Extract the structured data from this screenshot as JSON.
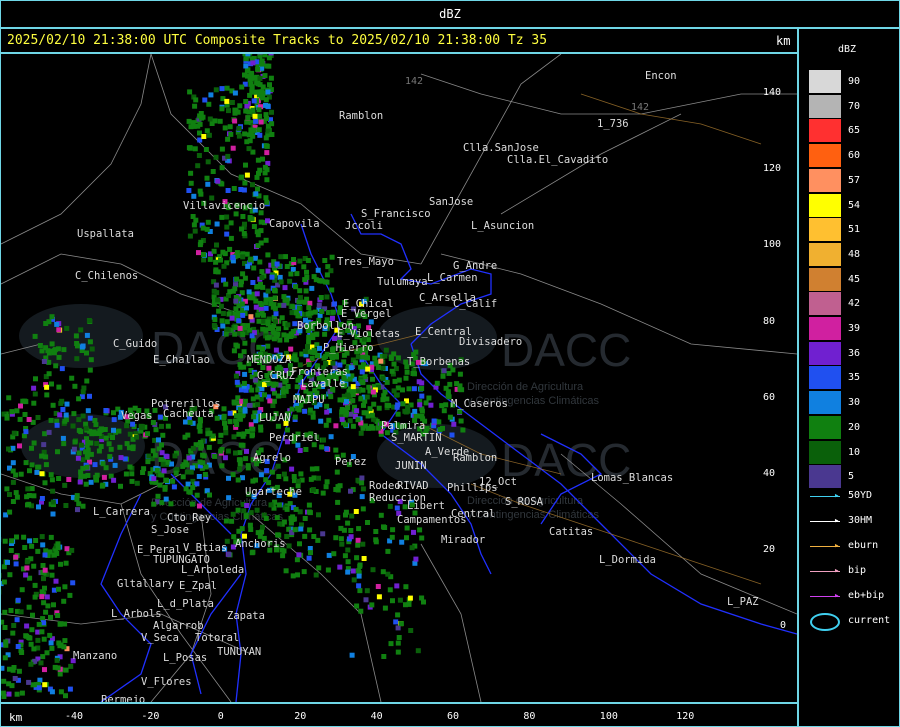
{
  "header": {
    "product": "dBZ"
  },
  "title": "2025/02/10 21:38:00 UTC Composite Tracks to 2025/02/10 21:38:00 Tz 35",
  "km_label_right": "km",
  "km_label_bottom": "km",
  "y_ticks": [
    "140",
    "120",
    "100",
    "80",
    "60",
    "40",
    "20",
    "0"
  ],
  "x_ticks": [
    "-40",
    "-20",
    "0",
    "20",
    "40",
    "60",
    "80",
    "100",
    "120"
  ],
  "legend": {
    "unit": "dBZ",
    "levels": [
      {
        "value": "90",
        "color": "#d8d8d8"
      },
      {
        "value": "70",
        "color": "#b4b4b4"
      },
      {
        "value": "65",
        "color": "#ff3030"
      },
      {
        "value": "60",
        "color": "#ff6010"
      },
      {
        "value": "57",
        "color": "#ff9060"
      },
      {
        "value": "54",
        "color": "#ffff00"
      },
      {
        "value": "51",
        "color": "#ffc030"
      },
      {
        "value": "48",
        "color": "#f0b030"
      },
      {
        "value": "45",
        "color": "#d08030"
      },
      {
        "value": "42",
        "color": "#c06090"
      },
      {
        "value": "39",
        "color": "#d020a0"
      },
      {
        "value": "36",
        "color": "#7020d0"
      },
      {
        "value": "35",
        "color": "#2050f0"
      },
      {
        "value": "30",
        "color": "#1080e0"
      },
      {
        "value": "20",
        "color": "#108010"
      },
      {
        "value": "10",
        "color": "#0a600a"
      },
      {
        "value": "5",
        "color": "#4a3890"
      }
    ]
  },
  "tracks": [
    {
      "label": "50YD",
      "color": "#40d0f0"
    },
    {
      "label": "30HM",
      "color": "#ffffff"
    },
    {
      "label": "eburn",
      "color": "#f0b040"
    },
    {
      "label": "bip",
      "color": "#f0a0c0"
    },
    {
      "label": "eb+bip",
      "color": "#d040f0"
    },
    {
      "label": "current",
      "color": "#40d0f0"
    }
  ],
  "watermark": {
    "name": "DACC",
    "subtitle1": "Dirección de Agricultura",
    "subtitle2": "y Contingencias Climáticas"
  },
  "places": [
    "Encon",
    "1_736",
    "Ramblon",
    "Clla.SanJose",
    "Clla.El_Cavadito",
    "S_Francisco",
    "SanJose",
    "Jccoli",
    "L_Asuncion",
    "Uspallata",
    "Villavicencio",
    "Capovila",
    "Tres_Mayo",
    "G_Andre",
    "Tulumaya",
    "L_Carmen",
    "C_Chilenos",
    "E_Chical",
    "C_Arsella",
    "C_Calif",
    "E_Vergel",
    "Borbollon",
    "E_Central",
    "Divisadero",
    "C_Guido",
    "E_Violetas",
    "P_Hierro",
    "E_Challao",
    "MENDOZA",
    "T_Borbenas",
    "G_CRUZ",
    "Lavalle",
    "Fronteras",
    "Potrerillos",
    "MAIPU",
    "M_Caseros",
    "Cacheuta",
    "LUJAN",
    "Palmira",
    "S_MARTIN",
    "Vegas",
    "Perdriel",
    "A_Verde",
    "Ugarteche",
    "Agrelo",
    "Perez",
    "JUNIN",
    "Ramblon",
    "Rodeo",
    "RIVAD",
    "Phillips",
    "12_Oct",
    "L_Carrera",
    "Reduccion",
    "Libert",
    "S_ROSA",
    "Lomas_Blancas",
    "Cto_Rey",
    "S_Jose",
    "Central",
    "Campamentos",
    "Catitas",
    "E_Peral",
    "Anchoris",
    "V_Btias",
    "TUPUNGATO",
    "Mirador",
    "L_Dormida",
    "L_Arboleda",
    "Gltallary",
    "E_Zpal",
    "L_PAZ",
    "L_d_Plata",
    "L_Arbols",
    "Zapata",
    "Algarrob",
    "V_Seca",
    "Totoral",
    "Manzano",
    "L_Posas",
    "TUNUYAN",
    "V_Flores",
    "Bermejo"
  ],
  "map_numbers": [
    "142"
  ]
}
